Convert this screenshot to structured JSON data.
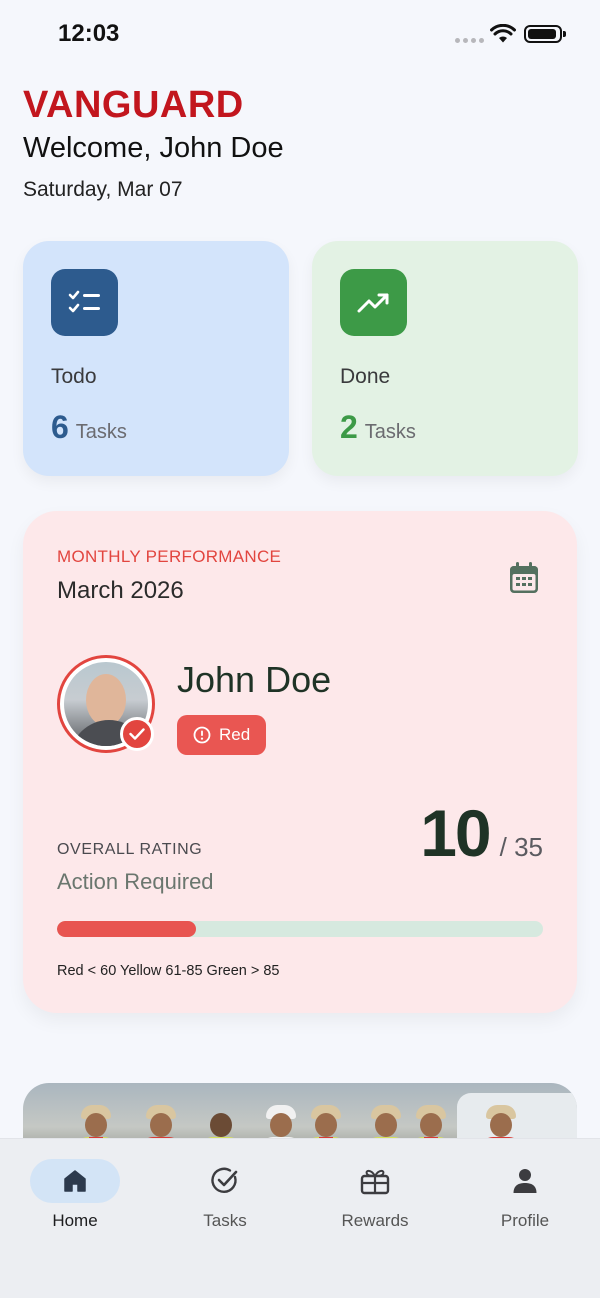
{
  "status_bar": {
    "time": "12:03"
  },
  "header": {
    "brand": "VANGUARD",
    "welcome": "Welcome, John Doe",
    "date": "Saturday, Mar 07"
  },
  "summary": {
    "todo": {
      "title": "Todo",
      "count": "6",
      "unit": "Tasks",
      "icon": "checklist-icon",
      "color": "#2d5b8e"
    },
    "done": {
      "title": "Done",
      "count": "2",
      "unit": "Tasks",
      "icon": "trending-up-icon",
      "color": "#3d9a47"
    }
  },
  "performance": {
    "label": "MONTHLY PERFORMANCE",
    "month": "March 2026",
    "icon": "calendar-icon",
    "name": "John Doe",
    "status": "Red",
    "status_color": "#e95652",
    "overall_label": "OVERALL RATING",
    "overall_status": "Action Required",
    "score": "10",
    "score_max": "/ 35",
    "progress_fraction": 0.2857,
    "legend": "Red < 60 Yellow 61-85 Green > 85"
  },
  "nav": {
    "items": [
      {
        "label": "Home",
        "icon": "home-icon",
        "active": true
      },
      {
        "label": "Tasks",
        "icon": "check-circle-icon",
        "active": false
      },
      {
        "label": "Rewards",
        "icon": "gift-icon",
        "active": false
      },
      {
        "label": "Profile",
        "icon": "person-icon",
        "active": false
      }
    ]
  }
}
